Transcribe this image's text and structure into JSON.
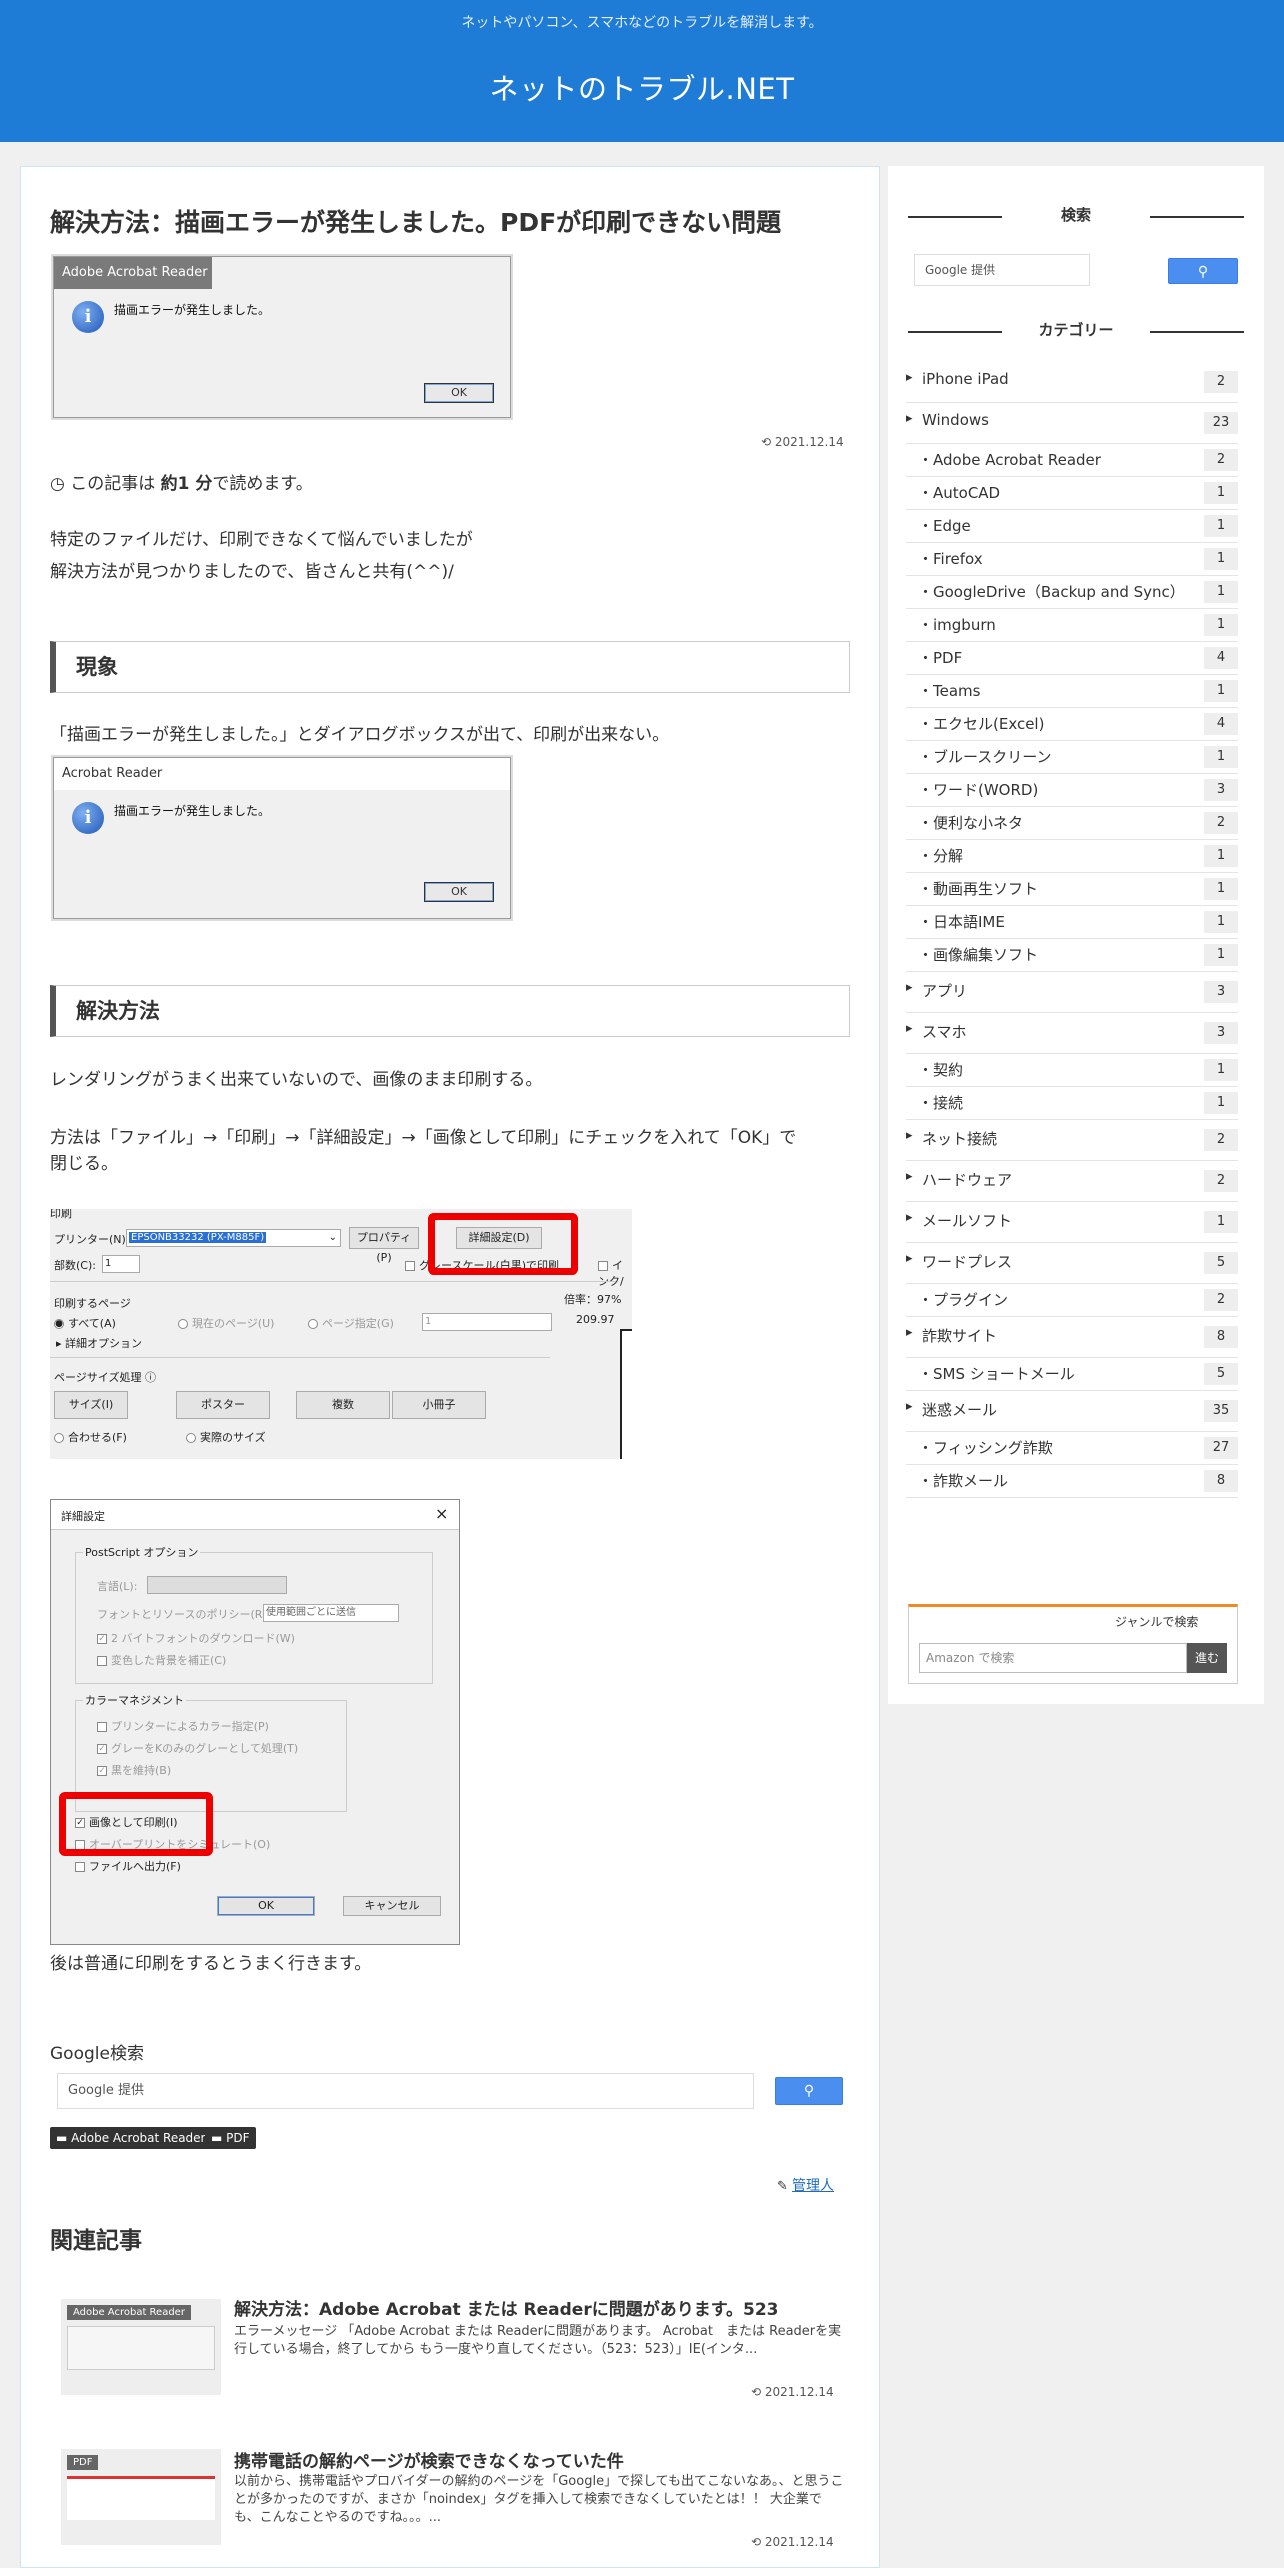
{
  "header": {
    "description": "ネットやパソコン、スマホなどのトラブルを解消します。",
    "site_title": "ネットのトラブル.NET"
  },
  "article": {
    "title": "解決方法：描画エラーが発生しました。PDFが印刷できない問題",
    "thumb_dialog": {
      "title": "Adobe Acrobat Reader",
      "message": "描画エラーが発生しました。",
      "ok": "OK"
    },
    "date": "2021.12.14",
    "reading_prefix": "この記事は",
    "reading_time": "約1 分",
    "reading_suffix": "で読めます。",
    "intro_line1": "特定のファイルだけ、印刷できなくて悩んでいましたが",
    "intro_line2": "解決方法が見つかりましたので、皆さんと共有(^^)/",
    "h2_symptom": "現象",
    "symptom_text": "「描画エラーが発生しました。」とダイアログボックスが出て、印刷が出来ない。",
    "symptom_dialog": {
      "title": "Acrobat Reader",
      "message": "描画エラーが発生しました。",
      "ok": "OK"
    },
    "h2_solution": "解決方法",
    "solution_text1": "レンダリングがうまく出来ていないので、画像のまま印刷する。",
    "solution_text2a": "方法は「ファイル」→「印刷」→「詳細設定」→「画像として印刷」にチェックを入れて「OK」で",
    "solution_text2b": "閉じる。",
    "print_dialog": {
      "print_label": "印刷",
      "printer_label": "プリンター(N):",
      "printer_value": "EPSONB33232 (PX-M885F)",
      "properties": "プロパティ(P)",
      "advanced": "詳細設定(D)",
      "copies_label": "部数(C):",
      "copies_value": "1",
      "grayscale": "グレースケール(白黒)で印刷",
      "ink": "インク/",
      "pages_heading": "印刷するページ",
      "all": "すべて(A)",
      "current": "現在のページ(U)",
      "specify": "ページ指定(G)",
      "specify_value": "1",
      "more_options": "詳細オプション",
      "zoom": "倍率：97%",
      "size_value": "209.97",
      "sizing_heading": "ページサイズ処理",
      "size_btn": "サイズ(I)",
      "poster_btn": "ポスター",
      "multiple_btn": "複数",
      "booklet_btn": "小冊子",
      "fit": "合わせる(F)",
      "actual": "実際のサイズ"
    },
    "advanced_dialog": {
      "title": "詳細設定",
      "close": "×",
      "postscript": "PostScript オプション",
      "level": "言語(L):",
      "font_policy": "フォントとリソースのポリシー(R):",
      "font_policy_value": "使用範囲ごとに送信",
      "download_fonts": "2 バイトフォントのダウンロード(W)",
      "discolor": "変色した背景を補正(C)",
      "color_mgmt": "カラーマネジメント",
      "printer_color": "プリンターによるカラー指定(P)",
      "gray_k": "グレーをKのみのグレーとして処理(T)",
      "keep_black": "黒を維持(B)",
      "print_as_image": "画像として印刷(I)",
      "overprint": "オーバープリントをシミュレート(O)",
      "print_to_file": "ファイルへ出力(F)",
      "ok": "OK",
      "cancel": "キャンセル"
    },
    "after_text": "後は普通に印刷をするとうまく行きます。",
    "google_search_label": "Google検索",
    "google_placeholder": "Google 提供",
    "tags": [
      "Adobe Acrobat Reader",
      "PDF"
    ],
    "author": "管理人",
    "related_heading": "関連記事",
    "related": [
      {
        "thumb_label": "Adobe Acrobat Reader",
        "title": "解決方法：Adobe Acrobat または Readerに問題があります。523",
        "snippet": "エラーメッセージ 「Adobe Acrobat または Readerに問題があります。 Acrobat　または Readerを実行している場合，終了してから もう一度やり直してください。（523：523）」IE(インタ...",
        "date": "2021.12.14"
      },
      {
        "thumb_label": "PDF",
        "title": "携帯電話の解約ページが検索できなくなっていた件",
        "snippet": "以前から、携帯電話やプロバイダーの解約のページを「Google」で探しても出てこないなあ。、と思うことが多かったのですが、まさか「noindex」タグを挿入して検索できなくしていたとは！！ 大企業でも、こんなことやるのですね。。。...",
        "date": "2021.12.14"
      }
    ]
  },
  "sidebar": {
    "search_heading": "検索",
    "search_placeholder": "Google 提供",
    "category_heading": "カテゴリー",
    "categories": [
      {
        "label": "iPhone iPad",
        "count": "2",
        "top": true
      },
      {
        "label": "Windows",
        "count": "23",
        "top": true
      },
      {
        "label": "・Adobe Acrobat Reader",
        "count": "2",
        "top": false
      },
      {
        "label": "・AutoCAD",
        "count": "1",
        "top": false
      },
      {
        "label": "・Edge",
        "count": "1",
        "top": false
      },
      {
        "label": "・Firefox",
        "count": "1",
        "top": false
      },
      {
        "label": "・GoogleDrive（Backup and Sync）",
        "count": "1",
        "top": false
      },
      {
        "label": "・imgburn",
        "count": "1",
        "top": false
      },
      {
        "label": "・PDF",
        "count": "4",
        "top": false
      },
      {
        "label": "・Teams",
        "count": "1",
        "top": false
      },
      {
        "label": "・エクセル(Excel)",
        "count": "4",
        "top": false
      },
      {
        "label": "・ブルースクリーン",
        "count": "1",
        "top": false
      },
      {
        "label": "・ワード(WORD)",
        "count": "3",
        "top": false
      },
      {
        "label": "・便利な小ネタ",
        "count": "2",
        "top": false
      },
      {
        "label": "・分解",
        "count": "1",
        "top": false
      },
      {
        "label": "・動画再生ソフト",
        "count": "1",
        "top": false
      },
      {
        "label": "・日本語IME",
        "count": "1",
        "top": false
      },
      {
        "label": "・画像編集ソフト",
        "count": "1",
        "top": false
      },
      {
        "label": "アプリ",
        "count": "3",
        "top": true
      },
      {
        "label": "スマホ",
        "count": "3",
        "top": true
      },
      {
        "label": "・契約",
        "count": "1",
        "top": false
      },
      {
        "label": "・接続",
        "count": "1",
        "top": false
      },
      {
        "label": "ネット接続",
        "count": "2",
        "top": true
      },
      {
        "label": "ハードウェア",
        "count": "2",
        "top": true
      },
      {
        "label": "メールソフト",
        "count": "1",
        "top": true
      },
      {
        "label": "ワードプレス",
        "count": "5",
        "top": true
      },
      {
        "label": "・プラグイン",
        "count": "2",
        "top": false
      },
      {
        "label": "詐欺サイト",
        "count": "8",
        "top": true
      },
      {
        "label": "・SMS ショートメール",
        "count": "5",
        "top": false
      },
      {
        "label": "迷惑メール",
        "count": "35",
        "top": true
      },
      {
        "label": "・フィッシング詐欺",
        "count": "27",
        "top": false
      },
      {
        "label": "・詐欺メール",
        "count": "8",
        "top": false
      }
    ],
    "amazon_genre": "ジャンルで検索",
    "amazon_placeholder": "Amazon で検索",
    "amazon_go": "進む"
  },
  "colors": {
    "header_bg": "#1e7bd6",
    "highlight_red": "#e00000",
    "search_btn": "#4a8ef0",
    "amazon_accent": "#f08a24"
  }
}
